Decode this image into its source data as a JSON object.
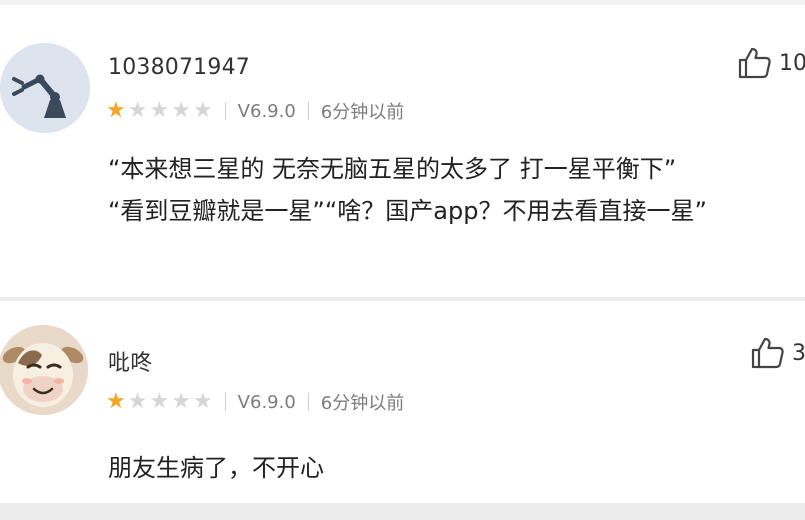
{
  "reviews": [
    {
      "username": "1038071947",
      "avatar_icon": "robot-arm-icon",
      "rating": 1,
      "max_rating": 5,
      "version": "V6.9.0",
      "time": "6分钟以前",
      "like_count": "10",
      "content": "“本来想三星的 无奈无脑五星的太多了 打一星平衡下”\n“看到豆瓣就是一星”“啥？国产app？不用去看直接一星”"
    },
    {
      "username": "吡咚",
      "avatar_icon": "cartoon-cow-avatar",
      "rating": 1,
      "max_rating": 5,
      "version": "V6.9.0",
      "time": "6分钟以前",
      "like_count": "3",
      "content": "朋友生病了，不开心"
    }
  ],
  "colors": {
    "star_filled": "#f5a623",
    "star_empty": "#d6d6d6",
    "text_primary": "#222222",
    "text_meta": "#7d7d7d",
    "background": "#f2f2f2"
  }
}
